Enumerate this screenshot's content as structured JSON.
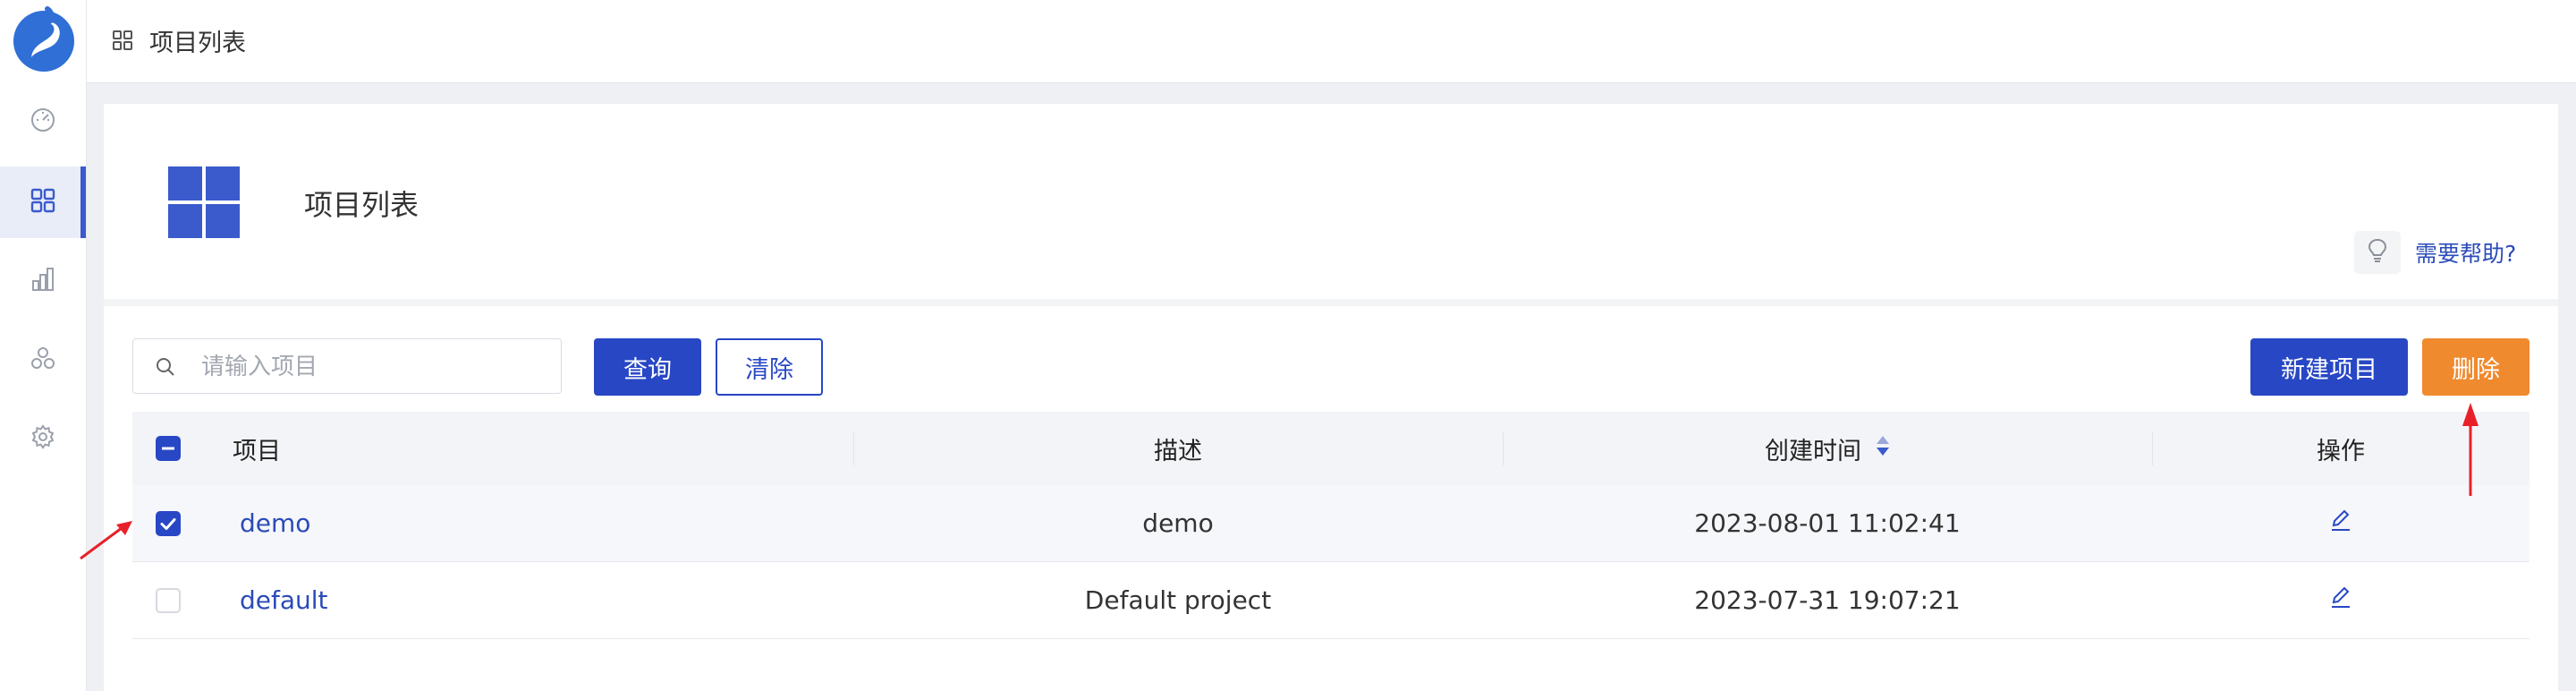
{
  "breadcrumb": {
    "label": "项目列表"
  },
  "header": {
    "title": "项目列表",
    "help_link": "需要帮助?"
  },
  "toolbar": {
    "search_placeholder": "请输入项目",
    "query_label": "查询",
    "clear_label": "清除",
    "new_label": "新建项目",
    "delete_label": "删除"
  },
  "table": {
    "columns": [
      "项目",
      "描述",
      "创建时间",
      "操作"
    ],
    "rows": [
      {
        "name": "demo",
        "description": "demo",
        "created": "2023-08-01 11:02:41",
        "selected": true
      },
      {
        "name": "default",
        "description": "Default project",
        "created": "2023-07-31 19:07:21",
        "selected": false
      }
    ]
  },
  "sidebar": {
    "items": [
      {
        "icon": "dashboard-icon",
        "active": false
      },
      {
        "icon": "grid-icon",
        "active": true
      },
      {
        "icon": "bar-chart-icon",
        "active": false
      },
      {
        "icon": "cluster-icon",
        "active": false
      },
      {
        "icon": "gear-icon",
        "active": false
      }
    ]
  },
  "colors": {
    "primary": "#2847c5",
    "delete": "#f08a2e",
    "annotation": "#e8202a"
  }
}
